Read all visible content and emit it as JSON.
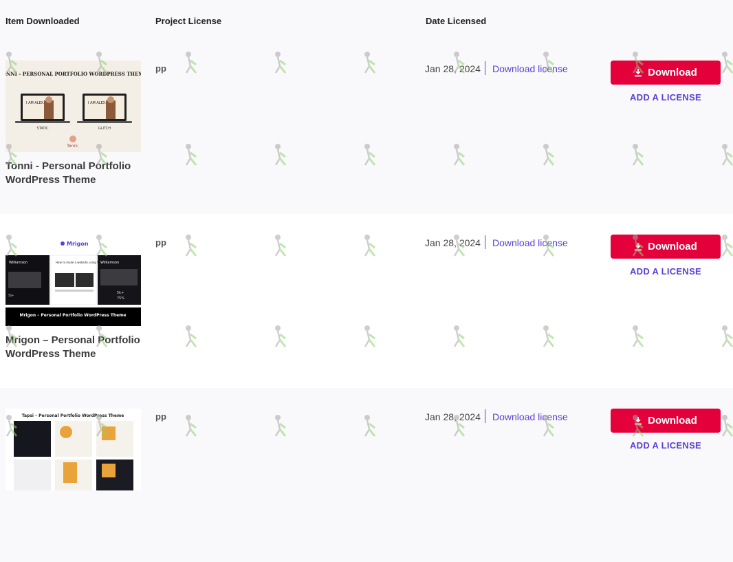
{
  "table": {
    "headers": {
      "item": "Item Downloaded",
      "license": "Project License",
      "date": "Date Licensed"
    }
  },
  "rows": [
    {
      "title": "Tonni - Personal Portfolio WordPress Theme",
      "license": "pp",
      "date": "Jan 28, 2024",
      "download_license": "Download license",
      "download_button": "Download",
      "add_license": "ADD A LICENSE",
      "thumb": {
        "banner": "TONNI - PERSONAL PORTFOLIO WORDPRESS THEME",
        "screen_text": "I AM ALEX.",
        "left_caption": "STATIC",
        "right_caption": "GLITCH",
        "logo": "Tonni."
      }
    },
    {
      "title": "Mrigon – Personal Portfolio WordPress Theme",
      "license": "pp",
      "date": "Jan 28, 2024",
      "download_license": "Download license",
      "download_button": "Download",
      "add_license": "ADD A LICENSE",
      "thumb": {
        "logo": "Mrigon",
        "name_left": "Williamson",
        "name_right": "Williamson",
        "center_title": "How to make a website using WordPress",
        "stats": [
          "50+",
          "5k+",
          "75%"
        ],
        "caption": "Mrigon – Personal Portfolio WordPress Theme"
      }
    },
    {
      "title": "",
      "license": "pp",
      "date": "Jan 28, 2024",
      "download_license": "Download license",
      "download_button": "Download",
      "add_license": "ADD A LICENSE",
      "thumb": {
        "banner": "Tapsi – Personal Portfolio WordPress Theme"
      }
    }
  ],
  "colors": {
    "accent": "#5b3fd6",
    "button": "#e4003a",
    "row_alt": "#f9f9fb"
  }
}
